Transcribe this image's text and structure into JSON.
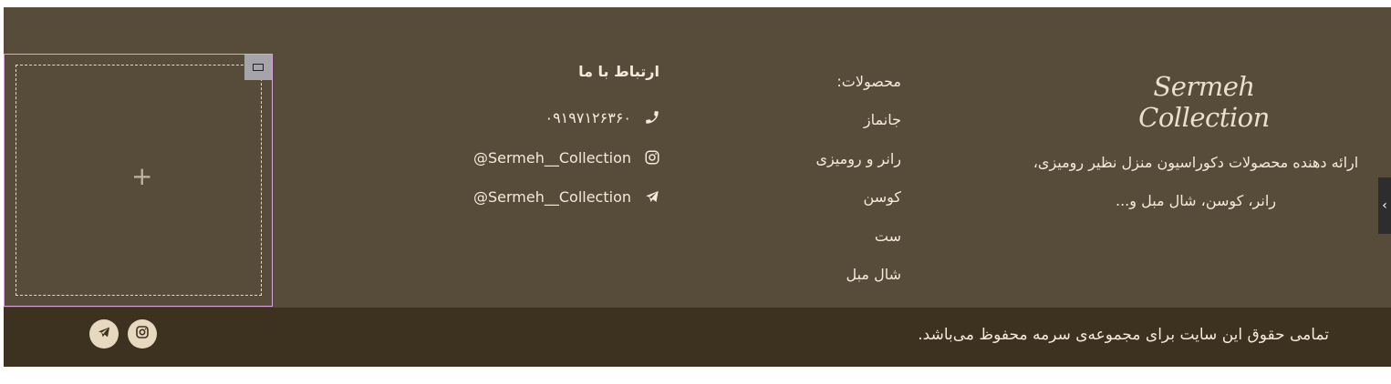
{
  "brand": {
    "logo_text": "Sermeh Collection",
    "description": "ارائه دهنده محصولات دکوراسیون منزل نظیر رومیزی، رانر، کوسن، شال مبل و..."
  },
  "products": {
    "heading": "محصولات:",
    "items": [
      "جانماز",
      "رانر و رومیزی",
      "کوسن",
      "ست",
      "شال مبل"
    ]
  },
  "contact": {
    "title": "ارتباط با ما",
    "phone": "۰۹۱۹۷۱۲۶۳۶۰",
    "instagram": "@Sermeh__Collection",
    "telegram": "@Sermeh__Collection"
  },
  "placeholder": {
    "plus": "+"
  },
  "bottom": {
    "copyright": "تمامی حقوق این سایت برای مجموعه‌ی سرمه محفوظ می‌باشد."
  },
  "side_handle": {
    "label": "‹"
  },
  "colors": {
    "footer_bg": "#564c39",
    "bottom_bg": "#3d3220",
    "text": "#f3ead9",
    "social_bg": "#e6d9c0"
  },
  "icons": {
    "phone": "phone-icon",
    "instagram": "instagram-icon",
    "telegram": "telegram-icon"
  }
}
